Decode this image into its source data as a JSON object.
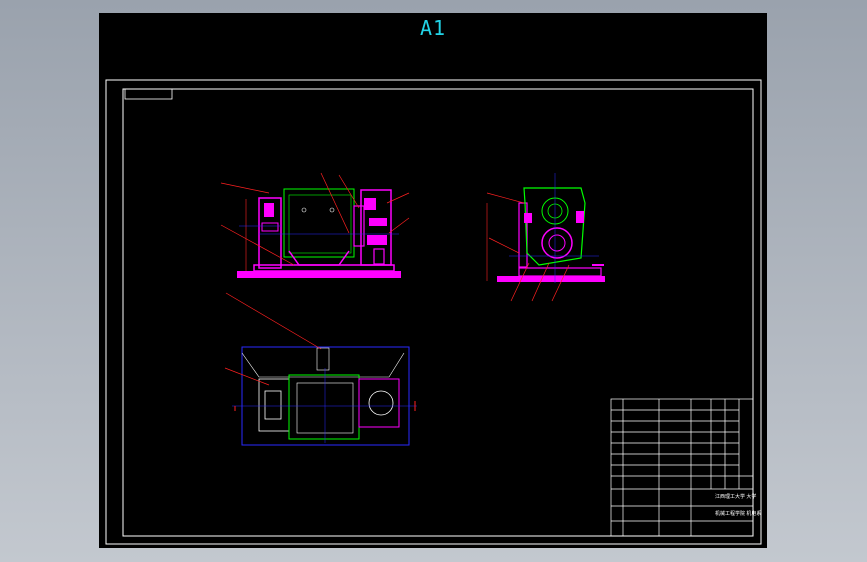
{
  "sheet": {
    "title": "A1"
  },
  "colors": {
    "background": "#000000",
    "border": "#ffffff",
    "part": "#ff00ff",
    "outline": "#2a2aff",
    "leader": "#ff2020",
    "frame": "#00ff00",
    "title_text": "#22d3e6"
  },
  "title_block": {
    "school_line1": "江西理工大学 大学",
    "school_line2": "机械工程学院 机电系"
  },
  "views": [
    "front-view",
    "side-view",
    "top-view"
  ]
}
